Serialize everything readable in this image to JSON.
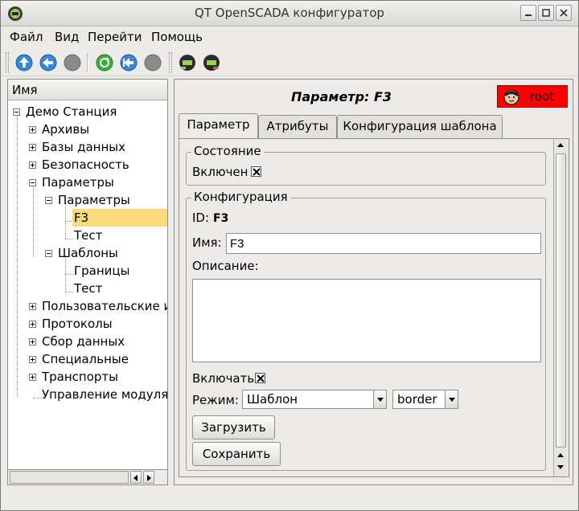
{
  "window": {
    "title": "QT OpenSCADA конфигуратор"
  },
  "menu": {
    "items": [
      {
        "label": "Файл"
      },
      {
        "label": "Вид"
      },
      {
        "label": "Перейти"
      },
      {
        "label": "Помощь"
      }
    ]
  },
  "toolbar": {
    "buttons": [
      {
        "icon": "up-arrow-icon"
      },
      {
        "icon": "back-arrow-icon"
      },
      {
        "icon": "stop-icon"
      },
      {
        "icon": "reload-icon"
      },
      {
        "icon": "forward-arrow-icon"
      },
      {
        "icon": "stop-icon"
      },
      {
        "icon": "network-icon"
      },
      {
        "icon": "network-icon"
      }
    ]
  },
  "tree": {
    "header": "Имя",
    "items": [
      {
        "label": "Демо Станция"
      },
      {
        "label": "Архивы"
      },
      {
        "label": "Базы данных"
      },
      {
        "label": "Безопасность"
      },
      {
        "label": "Параметры"
      },
      {
        "label": "Параметры"
      },
      {
        "label": "F3"
      },
      {
        "label": "Тест"
      },
      {
        "label": "Шаблоны"
      },
      {
        "label": "Границы"
      },
      {
        "label": "Тест"
      },
      {
        "label": "Пользовательские ин"
      },
      {
        "label": "Протоколы"
      },
      {
        "label": "Сбор данных"
      },
      {
        "label": "Специальные"
      },
      {
        "label": "Транспорты"
      },
      {
        "label": "Управление модулям"
      }
    ]
  },
  "panel": {
    "title": "Параметр: F3",
    "user": "root",
    "user_color": "#ff0000",
    "tabs": [
      {
        "label": "Параметр"
      },
      {
        "label": "Атрибуты"
      },
      {
        "label": "Конфигурация шаблона"
      }
    ],
    "state_group": {
      "title": "Состояние",
      "enabled_label": "Включен"
    },
    "config_group": {
      "title": "Конфигурация",
      "id_label": "ID:",
      "id_value": "F3",
      "name_label": "Имя:",
      "name_value": "F3",
      "description_label": "Описание:",
      "description_value": "",
      "enable_label": "Включать",
      "mode_label": "Режим:",
      "mode_value": "Шаблон",
      "mode_extra": "border"
    },
    "buttons": {
      "load": "Загрузить",
      "save": "Сохранить"
    }
  },
  "colors": {
    "selection": "#f9db7b"
  }
}
